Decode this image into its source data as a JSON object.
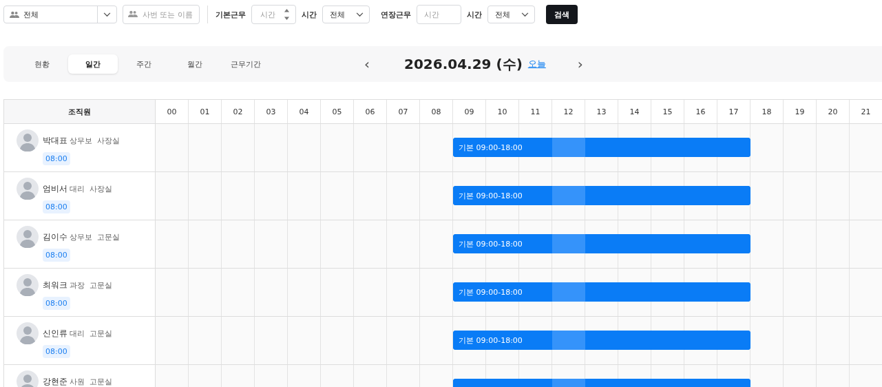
{
  "filters": {
    "org_select": {
      "value": "전체"
    },
    "search": {
      "placeholder": "사번 또는 이름"
    },
    "basic_work": {
      "label": "기본근무",
      "placeholder": "시간"
    },
    "basic_hours_label": "시간",
    "basic_hours_select": {
      "value": "전체"
    },
    "overtime_work": {
      "label": "연장근무",
      "placeholder": "시간"
    },
    "overtime_hours_label": "시간",
    "overtime_hours_select": {
      "value": "전체"
    },
    "search_button": "검색"
  },
  "tabs": [
    {
      "label": "현황",
      "selected": false
    },
    {
      "label": "일간",
      "selected": true
    },
    {
      "label": "주간",
      "selected": false
    },
    {
      "label": "월간",
      "selected": false
    },
    {
      "label": "근무기간",
      "selected": false
    }
  ],
  "date_nav": {
    "prev": "‹",
    "date": "2026.04.29 (수)",
    "today_link": "오늘",
    "next": "›"
  },
  "table": {
    "member_header": "조직원",
    "hours": [
      "00",
      "01",
      "02",
      "03",
      "04",
      "05",
      "06",
      "07",
      "08",
      "09",
      "10",
      "11",
      "12",
      "13",
      "14",
      "15",
      "16",
      "17",
      "18",
      "19",
      "20",
      "21"
    ],
    "rows": [
      {
        "name": "박대표",
        "position": "상무보",
        "department": "사장실",
        "work_time": "08:00",
        "shift": {
          "label": "기본 09:00-18:00",
          "segments": [
            {
              "kind": "work"
            },
            {
              "kind": "work"
            },
            {
              "kind": "work"
            },
            {
              "kind": "break"
            },
            {
              "kind": "work"
            },
            {
              "kind": "work"
            },
            {
              "kind": "work"
            },
            {
              "kind": "work"
            },
            {
              "kind": "work"
            }
          ]
        }
      },
      {
        "name": "엄비서",
        "position": "대리",
        "department": "사장실",
        "work_time": "08:00",
        "shift": {
          "label": "기본 09:00-18:00",
          "segments": [
            {
              "kind": "work"
            },
            {
              "kind": "work"
            },
            {
              "kind": "work"
            },
            {
              "kind": "break"
            },
            {
              "kind": "work"
            },
            {
              "kind": "work"
            },
            {
              "kind": "work"
            },
            {
              "kind": "work"
            },
            {
              "kind": "work"
            }
          ]
        }
      },
      {
        "name": "김이수",
        "position": "상무보",
        "department": "고문실",
        "work_time": "08:00",
        "shift": {
          "label": "기본 09:00-18:00",
          "segments": [
            {
              "kind": "work"
            },
            {
              "kind": "work"
            },
            {
              "kind": "work"
            },
            {
              "kind": "break"
            },
            {
              "kind": "work"
            },
            {
              "kind": "work"
            },
            {
              "kind": "work"
            },
            {
              "kind": "work"
            },
            {
              "kind": "work"
            }
          ]
        }
      },
      {
        "name": "최워크",
        "position": "과장",
        "department": "고문실",
        "work_time": "08:00",
        "shift": {
          "label": "기본 09:00-18:00",
          "segments": [
            {
              "kind": "work"
            },
            {
              "kind": "work"
            },
            {
              "kind": "work"
            },
            {
              "kind": "break"
            },
            {
              "kind": "work"
            },
            {
              "kind": "work"
            },
            {
              "kind": "work"
            },
            {
              "kind": "work"
            },
            {
              "kind": "work"
            }
          ]
        }
      },
      {
        "name": "신인류",
        "position": "대리",
        "department": "고문실",
        "work_time": "08:00",
        "shift": {
          "label": "기본 09:00-18:00",
          "segments": [
            {
              "kind": "work"
            },
            {
              "kind": "work"
            },
            {
              "kind": "work"
            },
            {
              "kind": "break"
            },
            {
              "kind": "work"
            },
            {
              "kind": "work"
            },
            {
              "kind": "work"
            },
            {
              "kind": "work"
            },
            {
              "kind": "work"
            }
          ]
        }
      },
      {
        "name": "강현준",
        "position": "사원",
        "department": "고문실",
        "shift": {
          "segments": [
            {
              "kind": "work"
            },
            {
              "kind": "work"
            },
            {
              "kind": "work"
            },
            {
              "kind": "break"
            },
            {
              "kind": "work"
            },
            {
              "kind": "work"
            },
            {
              "kind": "work"
            },
            {
              "kind": "work"
            },
            {
              "kind": "work"
            }
          ]
        }
      }
    ]
  }
}
